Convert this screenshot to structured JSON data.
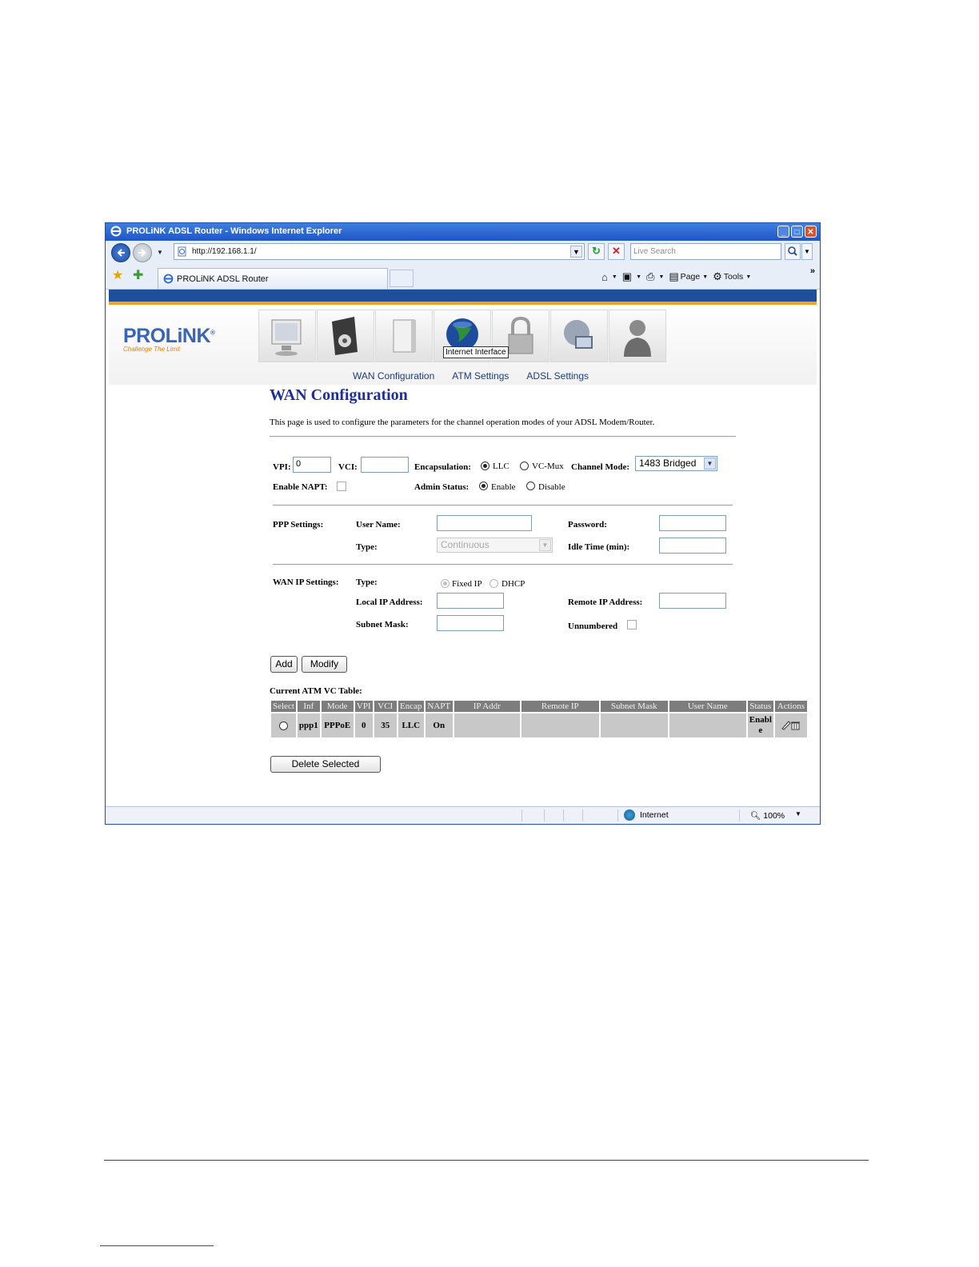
{
  "window": {
    "title": "PROLiNK ADSL Router - Windows Internet Explorer",
    "min": "_",
    "max": "□",
    "close": "✕"
  },
  "navbar": {
    "url": "http://192.168.1.1/",
    "search_placeholder": "Live Search"
  },
  "tabbar": {
    "tab_title": "PROLiNK ADSL Router",
    "commands": {
      "page": "Page",
      "tools": "Tools"
    }
  },
  "router": {
    "logo": "PROLiNK",
    "logo_mark": "®",
    "slogan": "Challenge The Limit",
    "icons": [
      "status-icon",
      "setup-icon",
      "device-icon",
      "internet-interface-icon",
      "security-icon",
      "network-icon",
      "admin-icon"
    ],
    "tooltip": "Internet Interface",
    "subnav": [
      "WAN Configuration",
      "ATM Settings",
      "ADSL Settings"
    ]
  },
  "wan": {
    "title": "WAN Configuration",
    "description": "This page is used to configure the parameters for the channel operation modes of your ADSL Modem/Router.",
    "vpi_label": "VPI:",
    "vpi_value": "0",
    "vci_label": "VCI:",
    "vci_value": "",
    "encap_label": "Encapsulation:",
    "encap_llc": "LLC",
    "encap_vcmux": "VC-Mux",
    "encap_selected": "LLC",
    "channel_mode_label": "Channel Mode:",
    "channel_mode_value": "1483 Bridged",
    "napt_label": "Enable NAPT:",
    "napt_checked": false,
    "admin_status_label": "Admin Status:",
    "admin_enable": "Enable",
    "admin_disable": "Disable",
    "admin_selected": "Enable",
    "ppp": {
      "section_label": "PPP Settings:",
      "username_label": "User Name:",
      "username_value": "",
      "password_label": "Password:",
      "password_value": "",
      "type_label": "Type:",
      "type_value": "Continuous",
      "idle_label": "Idle Time (min):",
      "idle_value": ""
    },
    "wanip": {
      "section_label": "WAN IP Settings:",
      "type_label": "Type:",
      "fixed_ip": "Fixed IP",
      "dhcp": "DHCP",
      "type_selected": "Fixed IP",
      "local_ip_label": "Local IP Address:",
      "local_ip_value": "",
      "remote_ip_label": "Remote IP Address:",
      "remote_ip_value": "",
      "subnet_label": "Subnet Mask:",
      "subnet_value": "",
      "unnumbered_label": "Unnumbered",
      "unnumbered_checked": false
    },
    "buttons": {
      "add": "Add",
      "modify": "Modify",
      "delete_selected": "Delete Selected"
    },
    "table": {
      "title": "Current ATM VC Table:",
      "columns": [
        "Select",
        "Inf",
        "Mode",
        "VPI",
        "VCI",
        "Encap",
        "NAPT",
        "IP Addr",
        "Remote IP",
        "Subnet Mask",
        "User Name",
        "Status",
        "Actions"
      ],
      "rows": [
        {
          "inf": "ppp1",
          "mode": "PPPoE",
          "vpi": "0",
          "vci": "35",
          "encap": "LLC",
          "napt": "On",
          "ip_addr": "",
          "remote_ip": "",
          "subnet_mask": "",
          "user_name": "",
          "status_line1": "Enabl",
          "status_line2": "e"
        }
      ]
    }
  },
  "statusbar": {
    "zone": "Internet",
    "zoom": "100%"
  }
}
